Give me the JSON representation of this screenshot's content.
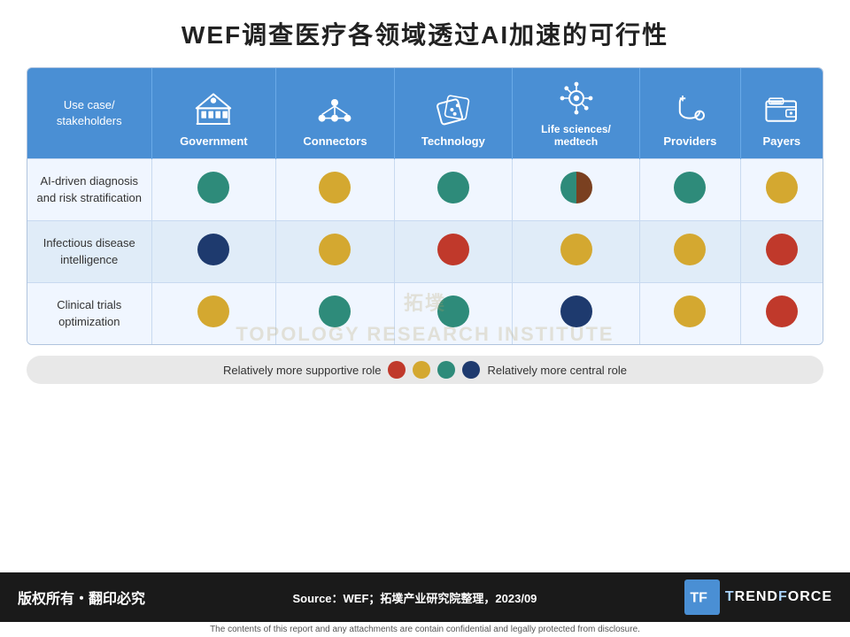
{
  "title": "WEF调查医疗各领域透过AI加速的可行性",
  "header": {
    "use_case_label": "Use case/ stakeholders",
    "columns": [
      {
        "id": "government",
        "label": "Government",
        "icon": "government"
      },
      {
        "id": "connectors",
        "label": "Connectors",
        "icon": "connectors"
      },
      {
        "id": "technology",
        "label": "Technology",
        "icon": "technology"
      },
      {
        "id": "lifesciences",
        "label": "Life sciences/ medtech",
        "icon": "lifesciences"
      },
      {
        "id": "providers",
        "label": "Providers",
        "icon": "providers"
      },
      {
        "id": "payers",
        "label": "Payers",
        "icon": "payers"
      }
    ]
  },
  "rows": [
    {
      "label": "AI-driven diagnosis and risk stratification",
      "dots": [
        "teal",
        "yellow",
        "teal",
        "split",
        "teal",
        "yellow"
      ]
    },
    {
      "label": "Infectious disease intelligence",
      "dots": [
        "navy",
        "yellow",
        "red",
        "yellow",
        "yellow",
        "red"
      ]
    },
    {
      "label": "Clinical trials optimization",
      "dots": [
        "yellow",
        "teal",
        "teal",
        "navy",
        "yellow",
        "red"
      ]
    }
  ],
  "legend": {
    "left_label": "Relatively more supportive role",
    "right_label": "Relatively more central role",
    "dots": [
      "red",
      "yellow",
      "teal",
      "navy"
    ]
  },
  "footer": {
    "copyright": "版权所有・翻印必究",
    "source": "Source：WEF；拓墣产业研究院整理，2023/09",
    "logo": "TrendForce",
    "disclaimer": "The contents of this report and any attachments are contain confidential and legally protected from disclosure."
  },
  "watermark_lines": [
    "拓墣",
    "TOPOLOGY RESEARCH INSTITUTE"
  ]
}
